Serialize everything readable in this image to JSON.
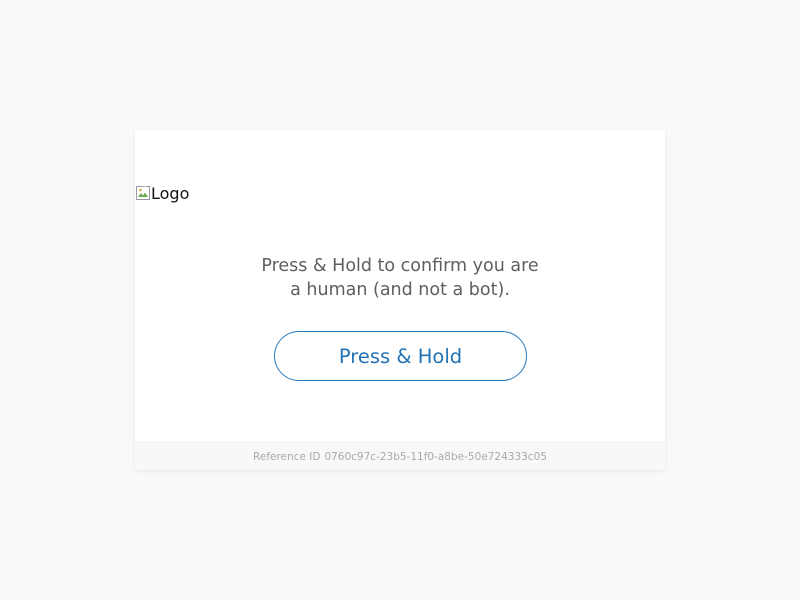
{
  "logo": {
    "alt_text": "Logo",
    "icon": "broken-image-icon"
  },
  "challenge": {
    "message_line1": "Press & Hold to confirm you are",
    "message_line2": "a human (and not a bot).",
    "button_label": "Press & Hold",
    "accent_color": "#2273b5"
  },
  "footer": {
    "reference_label": "Reference ID",
    "reference_id": "0760c97c-23b5-11f0-a8be-50e724333c05"
  }
}
